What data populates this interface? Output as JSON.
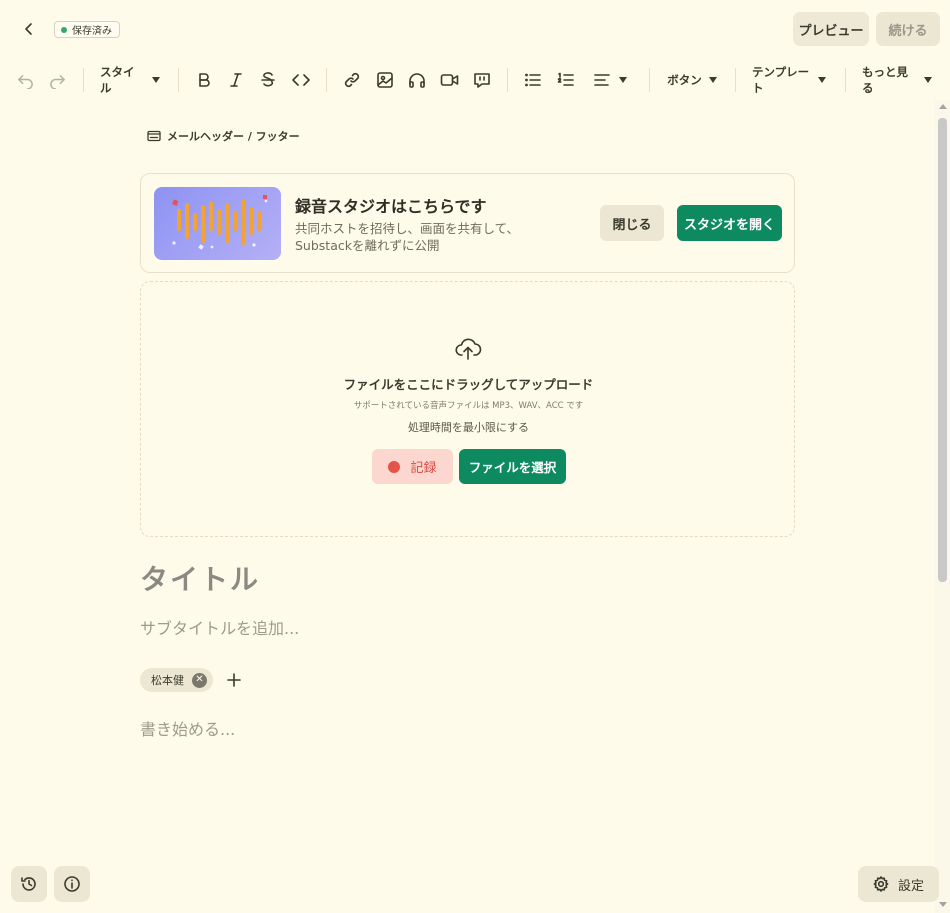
{
  "topbar": {
    "saved_status": "保存済み",
    "preview_label": "プレビュー",
    "continue_label": "続ける"
  },
  "toolbar": {
    "style_label": "スタイル",
    "button_label": "ボタン",
    "template_label": "テンプレート",
    "more_label": "もっと見る"
  },
  "editor": {
    "header_footer_label": "メールヘッダー / フッター",
    "title_placeholder": "タイトル",
    "subtitle_placeholder": "サブタイトルを追加...",
    "body_placeholder": "書き始める...",
    "author_name": "松本健"
  },
  "studio_banner": {
    "title": "録音スタジオはこちらです",
    "description": "共同ホストを招待し、画面を共有して、Substackを離れずに公開",
    "close_label": "閉じる",
    "open_label": "スタジオを開く"
  },
  "upload": {
    "title": "ファイルをここにドラッグしてアップロード",
    "supported": "サポートされている音声ファイルは MP3、WAV、ACC です",
    "minimize": "処理時間を最小限にする",
    "record_label": "記録",
    "choose_label": "ファイルを選択"
  },
  "bottom": {
    "settings_label": "設定"
  },
  "colors": {
    "background": "#fffbea",
    "accent_green": "#0d8a5f",
    "record_red": "#e5534b",
    "saved_dot": "#2ea86b"
  }
}
